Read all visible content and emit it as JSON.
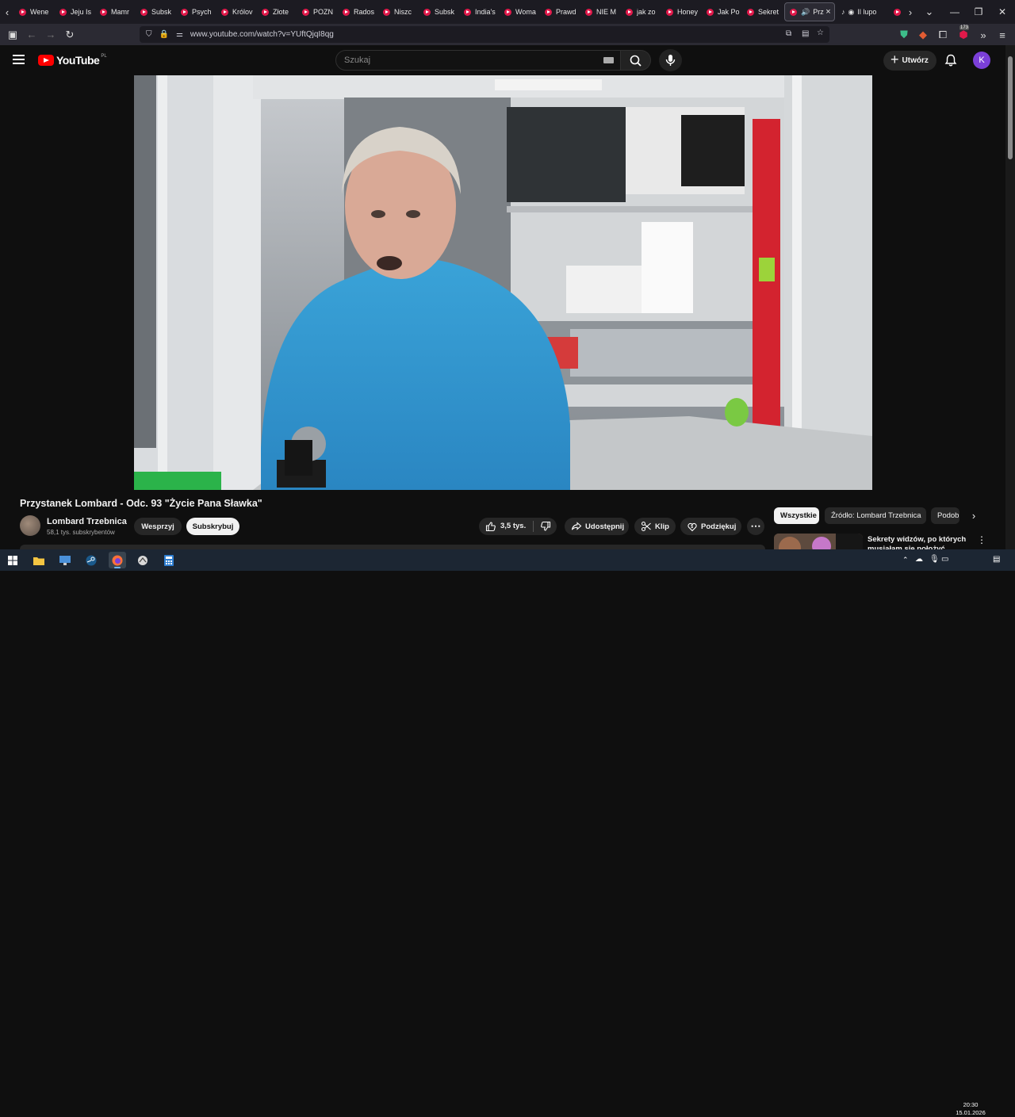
{
  "browser": {
    "tabs": [
      {
        "label": "Wene"
      },
      {
        "label": "Jeju Is"
      },
      {
        "label": "Mamr"
      },
      {
        "label": "Subsk"
      },
      {
        "label": "Psych"
      },
      {
        "label": "Królov"
      },
      {
        "label": "Złote"
      },
      {
        "label": "POZN"
      },
      {
        "label": "Rados"
      },
      {
        "label": "Niszc"
      },
      {
        "label": "Subsk"
      },
      {
        "label": "India's"
      },
      {
        "label": "Woma"
      },
      {
        "label": "Prawd"
      },
      {
        "label": "NIE M"
      },
      {
        "label": "jak zo"
      },
      {
        "label": "Honey"
      },
      {
        "label": "Jak Po"
      },
      {
        "label": "Sekret"
      }
    ],
    "active_tab": {
      "label": "Prz"
    },
    "next_tab": {
      "label": "Il lupo"
    },
    "url": "www.youtube.com/watch?v=YUftQjqI8qg",
    "extension_badge": "173"
  },
  "youtube": {
    "logo_text": "YouTube",
    "logo_country": "PL",
    "search_placeholder": "Szukaj",
    "create_label": "Utwórz",
    "avatar_letter": "K"
  },
  "video": {
    "title": "Przystanek Lombard - Odc. 93 \"Życie Pana Sławka\"",
    "channel": "Lombard Trzebnica",
    "subscribers": "58,1 tys. subskrybentów",
    "support_label": "Wesprzyj",
    "subscribe_label": "Subskrybuj",
    "likes": "3,5 tys.",
    "share_label": "Udostępnij",
    "clip_label": "Klip",
    "thanks_label": "Podziękuj"
  },
  "chips": [
    {
      "label": "Wszystkie",
      "active": true
    },
    {
      "label": "Źródło: Lombard Trzebnica",
      "active": false
    },
    {
      "label": "Podob",
      "active": false
    }
  ],
  "recommendation": {
    "title": "Sekrety widzów, po których musiałam się położyć"
  },
  "taskbar": {
    "time": "20:30",
    "date": "15.01.2026"
  },
  "colors": {
    "youtube_red": "#ff0000",
    "avatar_purple": "#7b3fd8",
    "background": "#0f0f0f"
  }
}
